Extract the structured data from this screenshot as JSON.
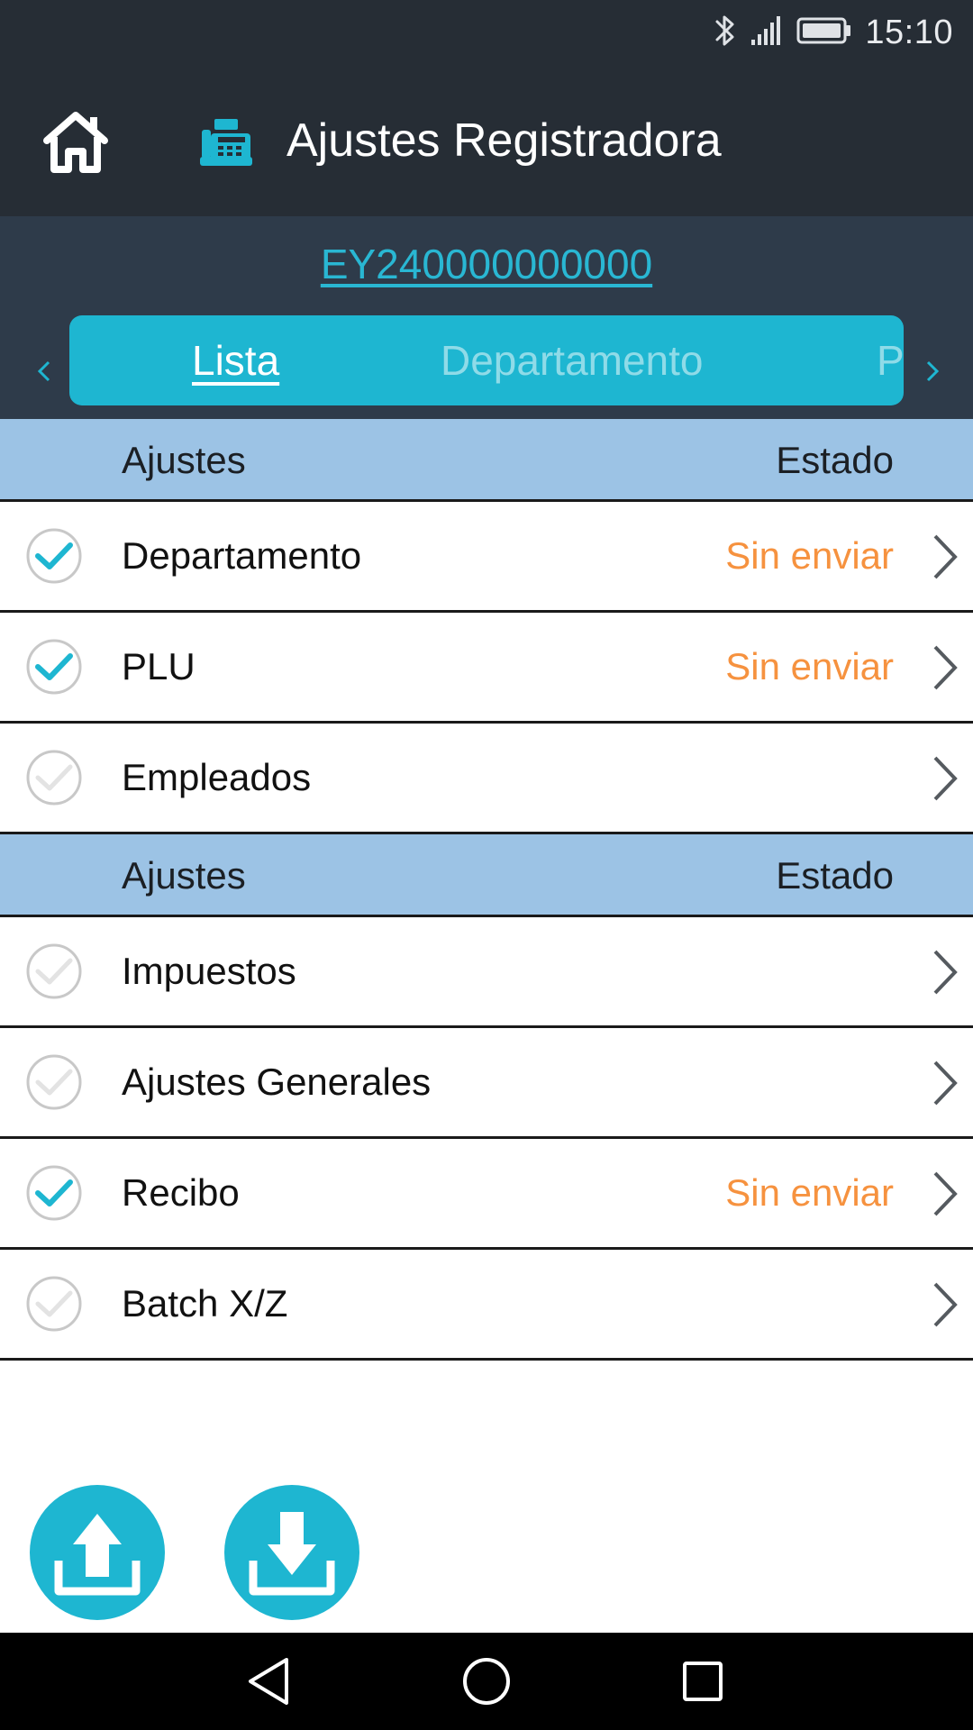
{
  "status_bar": {
    "time": "15:10",
    "icons": [
      "bluetooth-icon",
      "signal-icon",
      "battery-icon"
    ]
  },
  "header": {
    "title": "Ajustes Registradora",
    "home_icon": "home-icon",
    "app_icon": "cash-register-icon"
  },
  "device": {
    "serial": "EY240000000000"
  },
  "tabs": {
    "items": [
      {
        "label": "Lista",
        "active": true
      },
      {
        "label": "Departamento",
        "active": false
      },
      {
        "label": "P",
        "active": false
      }
    ],
    "prev_icon": "chevron-left-icon",
    "next_icon": "chevron-right-icon"
  },
  "sections": [
    {
      "col_left": "Ajustes",
      "col_right": "Estado",
      "rows": [
        {
          "label": "Departamento",
          "checked": true,
          "status": "Sin enviar"
        },
        {
          "label": "PLU",
          "checked": true,
          "status": "Sin enviar"
        },
        {
          "label": "Empleados",
          "checked": false,
          "status": ""
        }
      ]
    },
    {
      "col_left": "Ajustes",
      "col_right": "Estado",
      "rows": [
        {
          "label": "Impuestos",
          "checked": false,
          "status": ""
        },
        {
          "label": "Ajustes Generales",
          "checked": false,
          "status": ""
        },
        {
          "label": "Recibo",
          "checked": true,
          "status": "Sin enviar"
        },
        {
          "label": "Batch X/Z",
          "checked": false,
          "status": ""
        }
      ]
    }
  ],
  "actions": {
    "upload_icon": "upload-icon",
    "download_icon": "download-icon"
  },
  "nav_bar": {
    "items": [
      "back-icon",
      "home-circle-icon",
      "recent-apps-icon"
    ]
  },
  "colors": {
    "header_bg": "#262d35",
    "accent": "#1eb6d1",
    "section_bg": "#9cc3e5",
    "status_pending": "#f6923f"
  }
}
